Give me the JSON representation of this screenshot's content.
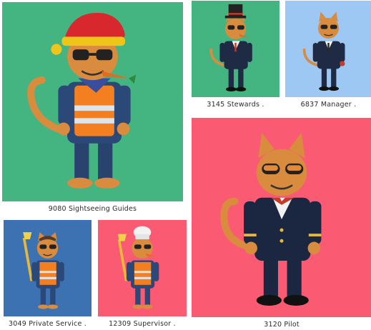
{
  "gallery": {
    "items": [
      {
        "label": "9080 Sightseeing Guides",
        "bg": "#44b581",
        "outfit": "guide",
        "accessory": "santa-hat"
      },
      {
        "label": "3145 Stewards .",
        "bg": "#44b581",
        "outfit": "suit",
        "accessory": "top-hat"
      },
      {
        "label": "6837 Manager .",
        "bg": "#9cc8f3",
        "outfit": "suit",
        "accessory": "none"
      },
      {
        "label": "3049 Private Service .",
        "bg": "#3c71b2",
        "outfit": "guide",
        "accessory": "torch"
      },
      {
        "label": "12309 Supervisor .",
        "bg": "#fb5a73",
        "outfit": "guide",
        "accessory": "chef-hat"
      },
      {
        "label": "3120 Pilot",
        "bg": "#fb5a73",
        "outfit": "pilot",
        "accessory": "none"
      }
    ]
  }
}
